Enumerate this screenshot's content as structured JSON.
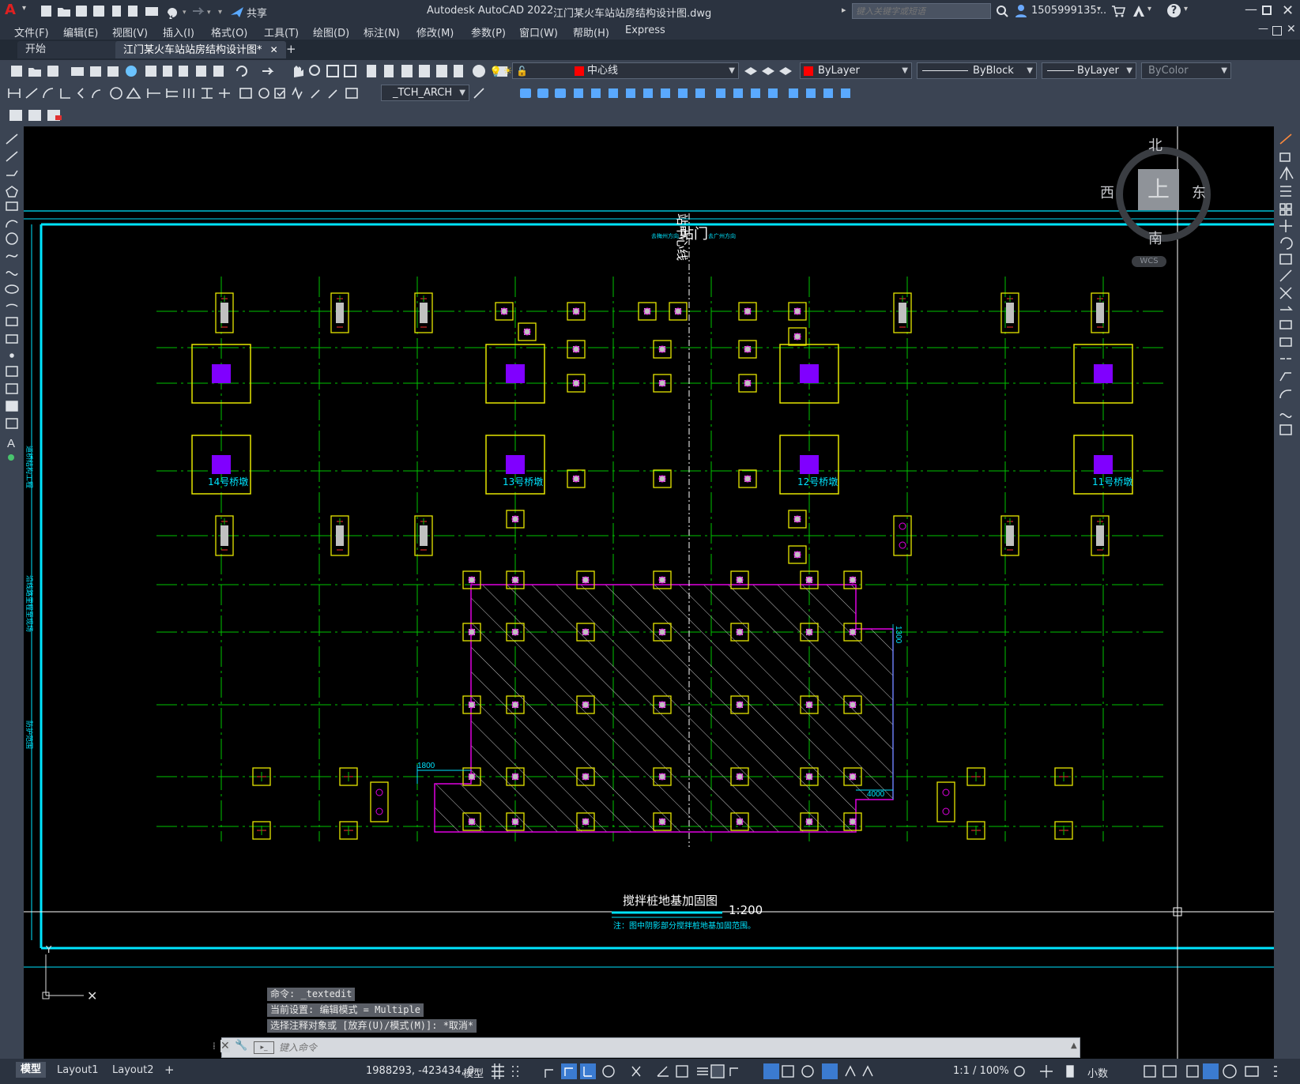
{
  "app": {
    "title": "Autodesk AutoCAD 2022",
    "file_title": "江门某火车站站房结构设计图.dwg",
    "logo": "A",
    "share_label": "共享",
    "search_placeholder": "键入关键字或短语",
    "user": "1505999135...",
    "help": "?"
  },
  "menu": [
    "文件(F)",
    "编辑(E)",
    "视图(V)",
    "插入(I)",
    "格式(O)",
    "工具(T)",
    "绘图(D)",
    "标注(N)",
    "修改(M)",
    "参数(P)",
    "窗口(W)",
    "帮助(H)",
    "Express"
  ],
  "tabs": {
    "start": "开始",
    "active": "江门某火车站站房结构设计图*",
    "close": "✕",
    "add": "+"
  },
  "toolbar": {
    "layer": "中心线",
    "color": "ByLayer",
    "linetype": "ByBlock",
    "lineweight": "ByLayer",
    "plotstyle": "ByColor",
    "textstyle": "_TCH_ARCH",
    "layer_color": "#ff0000"
  },
  "viewcube": {
    "north": "北",
    "south": "南",
    "east": "东",
    "west": "西",
    "top": "上",
    "wcs": "WCS"
  },
  "drawing": {
    "title": "搅拌桩地基加固图",
    "scale": "1:200",
    "note": "注：图中阴影部分搅拌桩地基加固范围。",
    "piers": [
      "14号桥墩",
      "13号桥墩",
      "12号桥墩",
      "11号桥墩"
    ],
    "dims": [
      "1800",
      "4000",
      "1300"
    ],
    "axis_label": "站中心线",
    "door_label": "站门",
    "door_left": "去梅州方向",
    "door_right": "去广州方向",
    "left_note1": "沿线路里程至现场",
    "left_note2": "道桥结构工程",
    "left_note3": "防护范围",
    "colors": {
      "grid": "#00c400",
      "footing": "#e6e600",
      "hatch": "#e000e0",
      "pier": "#8000ff",
      "frame": "#00e5ff",
      "dim": "#00e5ff"
    }
  },
  "command": {
    "lines": [
      "命令: _textedit",
      "当前设置: 编辑模式 = Multiple",
      "选择注释对象或 [放弃(U)/模式(M)]: *取消*"
    ],
    "placeholder": "键入命令"
  },
  "status": {
    "layouts": [
      "模型",
      "Layout1",
      "Layout2"
    ],
    "add": "+",
    "coords": "1988293, -423434, 0",
    "space": "模型",
    "scale": "1:1 / 100%",
    "units": "小数"
  }
}
